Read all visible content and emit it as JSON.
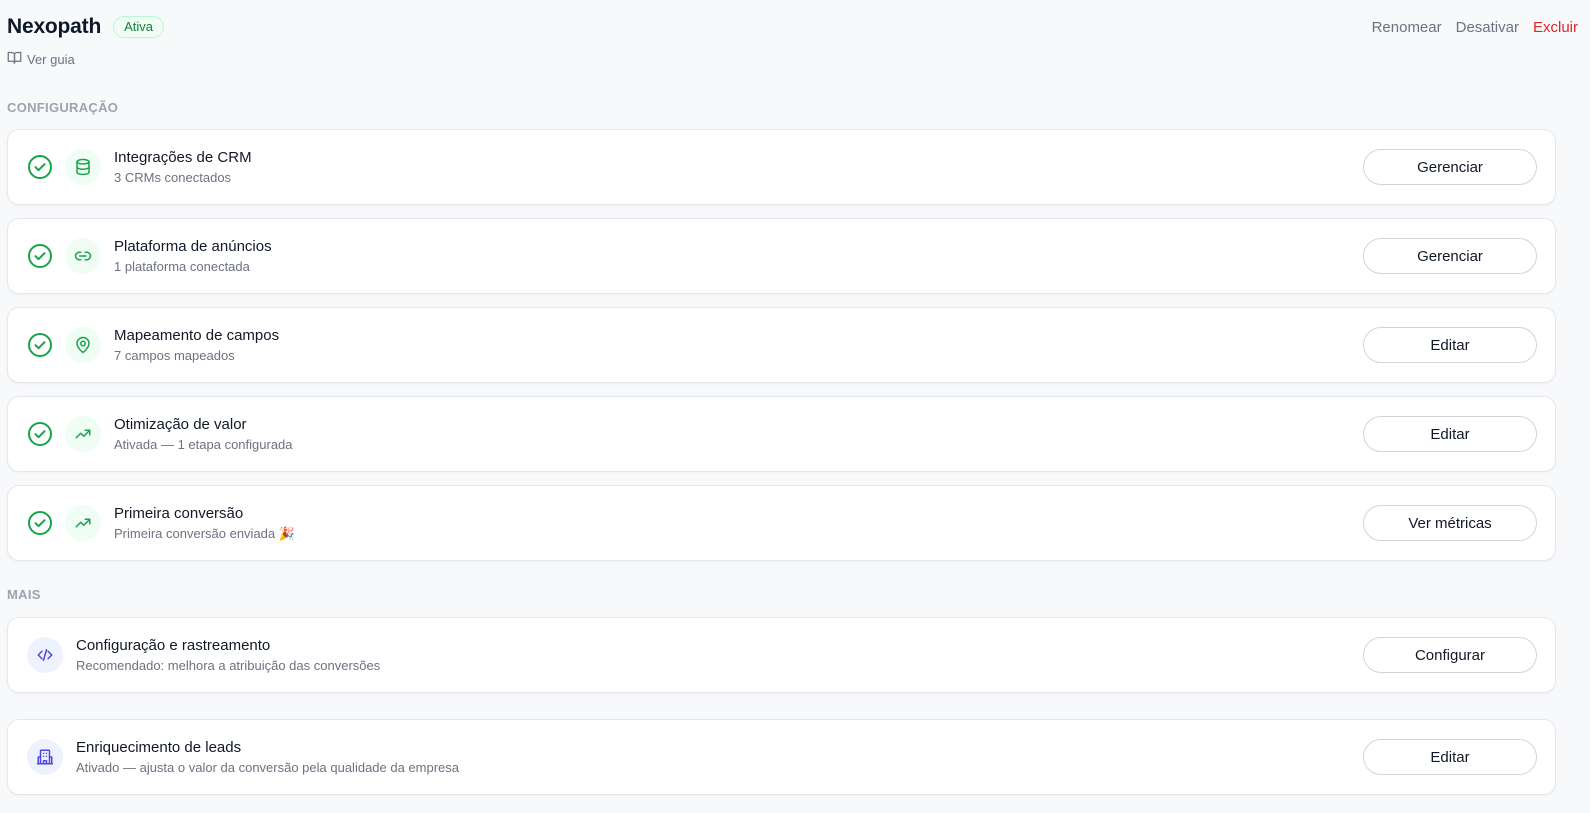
{
  "header": {
    "title": "Nexopath",
    "status": "Ativa",
    "actions": {
      "rename": "Renomear",
      "deactivate": "Desativar",
      "delete": "Excluir"
    },
    "guide_link": "Ver guia"
  },
  "sections": {
    "config_label": "CONFIGURAÇÃO",
    "more_label": "MAIS"
  },
  "config_items": [
    {
      "icon": "database-icon",
      "title": "Integrações de CRM",
      "subtitle": "3 CRMs conectados",
      "button": "Gerenciar",
      "status": "done"
    },
    {
      "icon": "link-icon",
      "title": "Plataforma de anúncios",
      "subtitle": "1 plataforma conectada",
      "button": "Gerenciar",
      "status": "done"
    },
    {
      "icon": "map-pin-icon",
      "title": "Mapeamento de campos",
      "subtitle": "7 campos mapeados",
      "button": "Editar",
      "status": "done"
    },
    {
      "icon": "trending-up-icon",
      "title": "Otimização de valor",
      "subtitle": "Ativada — 1 etapa configurada",
      "button": "Editar",
      "status": "done"
    },
    {
      "icon": "trending-up-icon",
      "title": "Primeira conversão",
      "subtitle": "Primeira conversão enviada 🎉",
      "button": "Ver métricas",
      "status": "done"
    }
  ],
  "more_items": [
    {
      "icon": "code-icon",
      "title": "Configuração e rastreamento",
      "subtitle": "Recomendado: melhora a atribuição das conversões",
      "button": "Configurar"
    },
    {
      "icon": "building-icon",
      "title": "Enriquecimento de leads",
      "subtitle": "Ativado — ajusta o valor da conversão pela qualidade da empresa",
      "button": "Editar"
    }
  ],
  "colors": {
    "success": "#16a34a",
    "danger": "#dc2626",
    "accent_purple": "#4f46e5"
  }
}
